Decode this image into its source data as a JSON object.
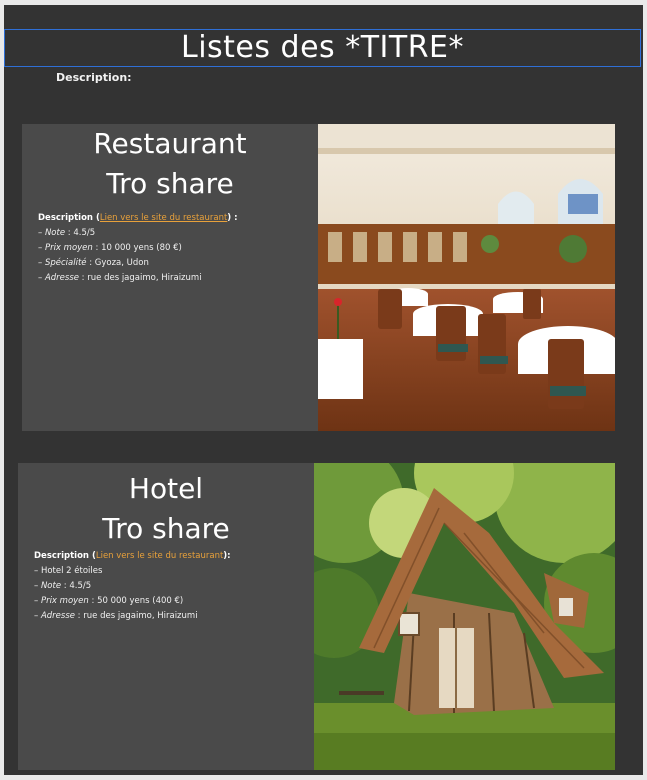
{
  "page": {
    "title": "Listes des *TITRE*",
    "description_label": "Description:"
  },
  "restaurant": {
    "title_line1": "Restaurant",
    "title_line2": "Tro share",
    "desc_label": "Description",
    "link_text": "Lien vers le site du restaurant",
    "desc_suffix": ") :",
    "note_label": "Note",
    "note_value": " : 4.5/5",
    "price_label": "Prix moyen",
    "price_value": " : 10 000 yens (80 €)",
    "specialty_label": "Spécialité",
    "specialty_value": " : Gyoza, Udon",
    "address_label": "Adresse",
    "address_value": " : rue des jagaimo, Hiraizumi",
    "image_alt": "restaurant dining room"
  },
  "hotel": {
    "title_line1": "Hotel",
    "title_line2": "Tro share",
    "desc_label": "Description",
    "link_text": "Lien vers le site du restaurant",
    "desc_suffix": "):",
    "stars": "– Hotel 2 étoiles",
    "note_label": "Note",
    "note_value": " : 4.5/5",
    "price_label": "Prix moyen",
    "price_value": " : 50 000 yens (400 €)",
    "address_label": "Adresse",
    "address_value": " : rue des jagaimo, Hiraizumi",
    "image_alt": "wooden crooked house"
  }
}
